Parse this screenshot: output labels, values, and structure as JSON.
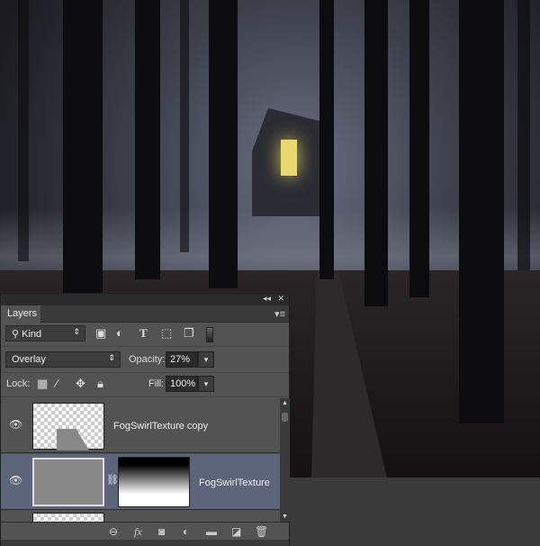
{
  "panel": {
    "title": "Layers",
    "collapse_icon": "◂◂",
    "close_icon": "✕",
    "menu_icon": "▾≡"
  },
  "filter": {
    "kind_label": "Kind"
  },
  "blend": {
    "mode": "Overlay",
    "opacity_label": "Opacity:",
    "opacity_value": "27%"
  },
  "lock": {
    "label": "Lock:",
    "fill_label": "Fill:",
    "fill_value": "100%"
  },
  "layers": [
    {
      "name": "FogSwirlTexture copy",
      "visible": true,
      "selected": false
    },
    {
      "name": "FogSwirlTexture",
      "visible": true,
      "selected": true,
      "has_mask": true
    }
  ],
  "colors": {
    "selected_row": "#5c6479",
    "panel": "#535353"
  }
}
